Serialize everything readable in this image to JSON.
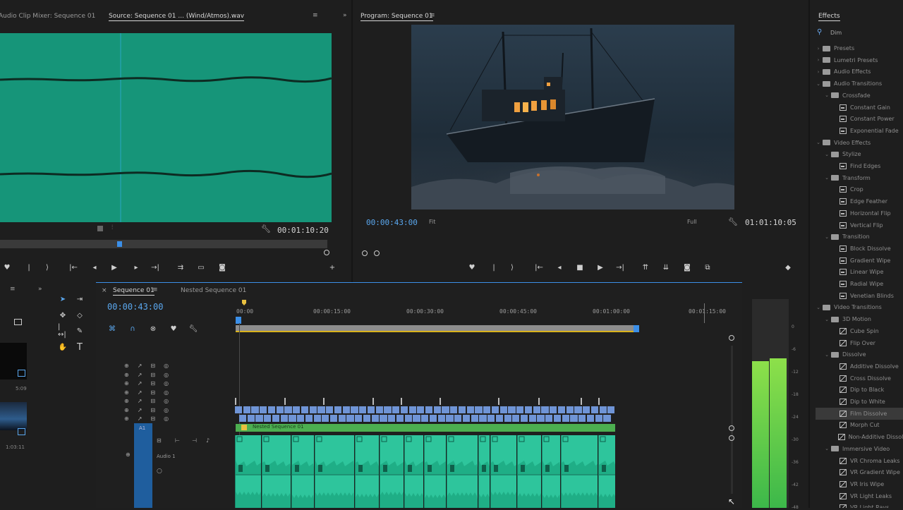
{
  "source_monitor": {
    "tabs": [
      "Audio Clip Mixer: Sequence 01",
      "Source: Sequence 01 ... (Wind/Atmos).wav"
    ],
    "active_tab_index": 1,
    "timecode": "00:01:10:20",
    "waveform_color": "#169579"
  },
  "program_monitor": {
    "tab": "Program: Sequence 01",
    "timecode_current": "00:00:43:00",
    "fit_label": "Fit",
    "full_label": "Full",
    "timecode_duration": "01:01:10:05"
  },
  "effects_panel": {
    "tab": "Effects",
    "search_value": "Dim",
    "items": [
      {
        "label": "Presets",
        "type": "folder",
        "level": 0
      },
      {
        "label": "Lumetri Presets",
        "type": "folder",
        "level": 0
      },
      {
        "label": "Audio Effects",
        "type": "folder",
        "level": 0
      },
      {
        "label": "Audio Transitions",
        "type": "folder",
        "level": 0
      },
      {
        "label": "Crossfade",
        "type": "folder",
        "level": 1
      },
      {
        "label": "Constant Gain",
        "type": "fx",
        "level": 2
      },
      {
        "label": "Constant Power",
        "type": "fx",
        "level": 2
      },
      {
        "label": "Exponential Fade",
        "type": "fx",
        "level": 2
      },
      {
        "label": "Video Effects",
        "type": "folder",
        "level": 0
      },
      {
        "label": "Stylize",
        "type": "folder",
        "level": 1
      },
      {
        "label": "Find Edges",
        "type": "fx",
        "level": 2
      },
      {
        "label": "Transform",
        "type": "folder",
        "level": 1
      },
      {
        "label": "Crop",
        "type": "fx",
        "level": 2
      },
      {
        "label": "Edge Feather",
        "type": "fx",
        "level": 2
      },
      {
        "label": "Horizontal Flip",
        "type": "fx",
        "level": 2
      },
      {
        "label": "Vertical Flip",
        "type": "fx",
        "level": 2
      },
      {
        "label": "Transition",
        "type": "folder",
        "level": 1
      },
      {
        "label": "Block Dissolve",
        "type": "fx",
        "level": 2
      },
      {
        "label": "Gradient Wipe",
        "type": "fx",
        "level": 2
      },
      {
        "label": "Linear Wipe",
        "type": "fx",
        "level": 2
      },
      {
        "label": "Radial Wipe",
        "type": "fx",
        "level": 2
      },
      {
        "label": "Venetian Blinds",
        "type": "fx",
        "level": 2
      },
      {
        "label": "Video Transitions",
        "type": "folder",
        "level": 0
      },
      {
        "label": "3D Motion",
        "type": "folder",
        "level": 1
      },
      {
        "label": "Cube Spin",
        "type": "tr",
        "level": 2
      },
      {
        "label": "Flip Over",
        "type": "tr",
        "level": 2
      },
      {
        "label": "Dissolve",
        "type": "folder",
        "level": 1
      },
      {
        "label": "Additive Dissolve",
        "type": "tr",
        "level": 2
      },
      {
        "label": "Cross Dissolve",
        "type": "tr",
        "level": 2
      },
      {
        "label": "Dip to Black",
        "type": "tr",
        "level": 2
      },
      {
        "label": "Dip to White",
        "type": "tr",
        "level": 2
      },
      {
        "label": "Film Dissolve",
        "type": "tr",
        "level": 2
      },
      {
        "label": "Morph Cut",
        "type": "tr",
        "level": 2
      },
      {
        "label": "Non-Additive Dissolve",
        "type": "tr",
        "level": 2
      },
      {
        "label": "Immersive Video",
        "type": "folder",
        "level": 1
      },
      {
        "label": "VR Chroma Leaks",
        "type": "tr",
        "level": 2
      },
      {
        "label": "VR Gradient Wipe",
        "type": "tr",
        "level": 2
      },
      {
        "label": "VR Iris Wipe",
        "type": "tr",
        "level": 2
      },
      {
        "label": "VR Light Leaks",
        "type": "tr",
        "level": 2
      },
      {
        "label": "VR Light Rays",
        "type": "tr",
        "level": 2
      }
    ],
    "selected_index": 31
  },
  "project_panel": {
    "thumb1_label": "5:09",
    "thumb2_label": "1:03:11"
  },
  "timeline": {
    "tabs": [
      "Sequence 01",
      "Nested Sequence 01"
    ],
    "active_tab_index": 0,
    "timecode": "00:00:43:00",
    "ruler_labels": [
      "00:00",
      "00:00:15:00",
      "00:00:30:00",
      "00:00:45:00",
      "00:01:00:00",
      "00:01:15:00"
    ],
    "nested_clip_label": "Nested Sequence 01",
    "audio_track_name": "Audio 1",
    "colors": {
      "video_clip": "#6f94d6",
      "nested_clip": "#4caf50",
      "audio_clip": "#2ec59c",
      "accent": "#3b8fe8"
    }
  },
  "meters": {
    "scale": [
      "0",
      "-6",
      "-12",
      "-18",
      "-24",
      "-30",
      "-36",
      "-42",
      "-48"
    ],
    "left_level": 0.88,
    "right_level": 0.9
  }
}
